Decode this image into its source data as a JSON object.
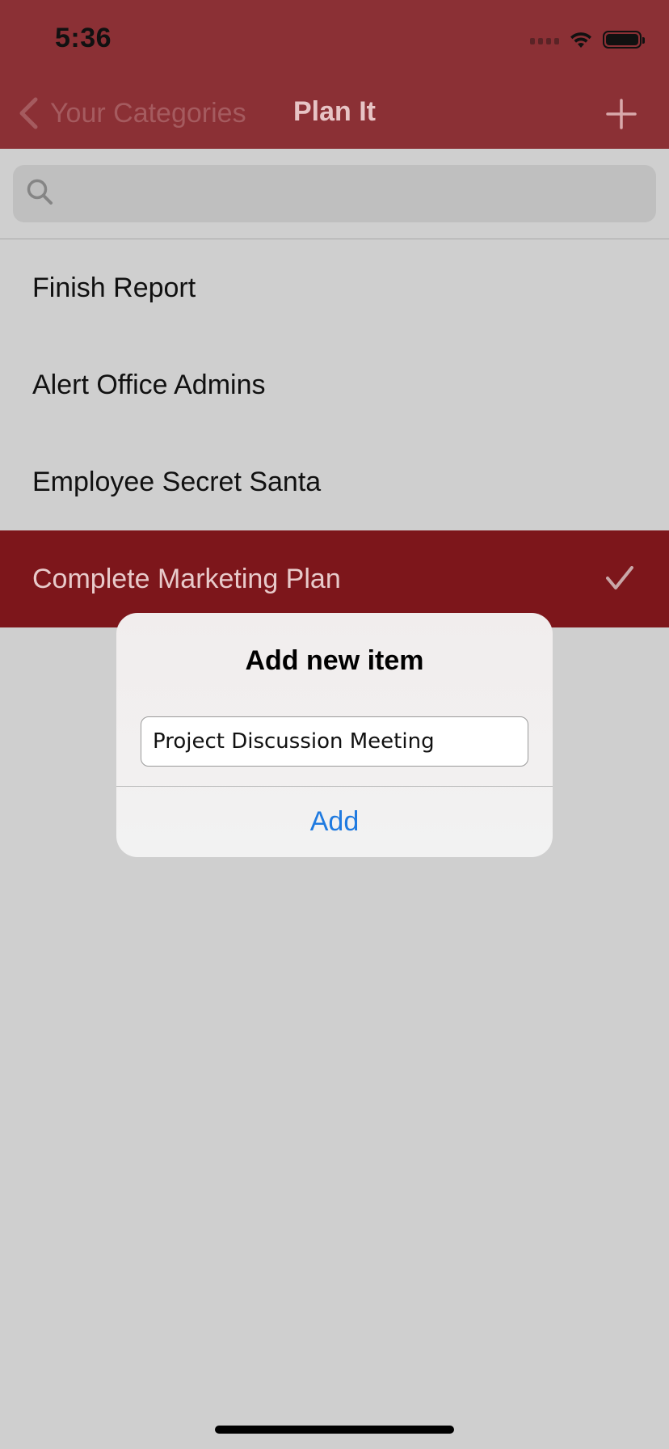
{
  "status_bar": {
    "time": "5:36"
  },
  "nav": {
    "back_label": "Your Categories",
    "title": "Plan It"
  },
  "search": {
    "value": ""
  },
  "items": [
    {
      "label": "Finish Report",
      "selected": false
    },
    {
      "label": "Alert Office Admins",
      "selected": false
    },
    {
      "label": "Employee Secret Santa",
      "selected": false
    },
    {
      "label": "Complete Marketing Plan",
      "selected": true
    }
  ],
  "alert": {
    "title": "Add new item",
    "input_value": "Project Discussion Meeting",
    "button_label": "Add"
  },
  "colors": {
    "nav_background": "#8b3035",
    "selected_row": "#7d161b",
    "accent_blue": "#1f7ae0",
    "page_background": "#cfcfcf"
  },
  "icons": [
    "chevron-left-icon",
    "plus-icon",
    "search-icon",
    "checkmark-icon",
    "wifi-icon",
    "battery-icon",
    "cellular-signal-icon"
  ]
}
